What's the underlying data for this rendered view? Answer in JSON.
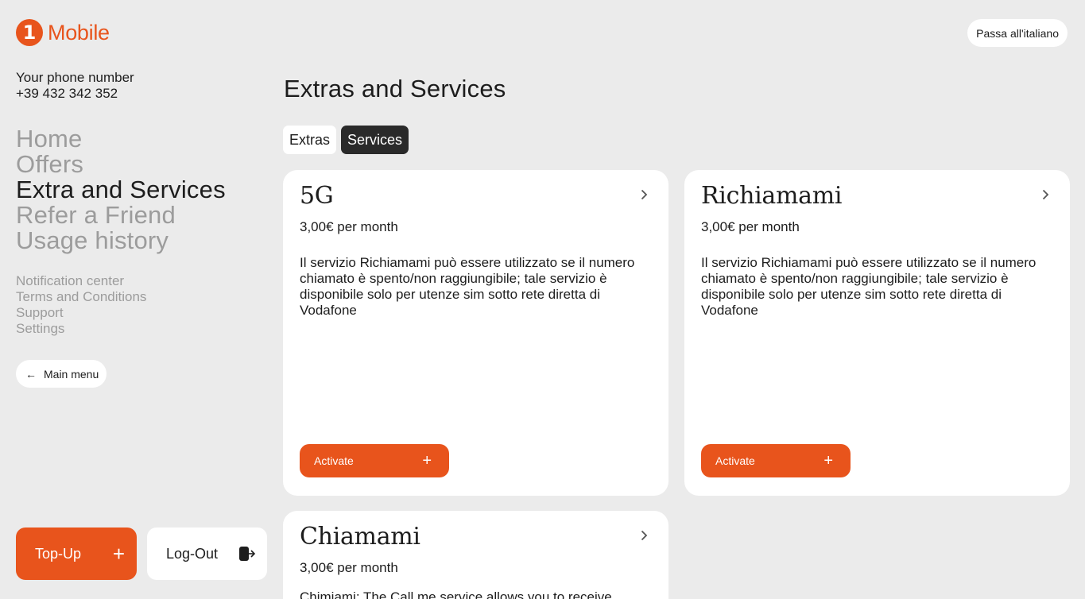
{
  "brand": {
    "logo_mark": "1",
    "name": "Mobile",
    "accent": "#e8541c"
  },
  "language_switch": "Passa all'italiano",
  "account": {
    "phone_label": "Your phone number",
    "phone_number": "+39 432 342 352"
  },
  "main_nav": [
    {
      "label": "Home",
      "active": false
    },
    {
      "label": "Offers",
      "active": false
    },
    {
      "label": "Extra and Services",
      "active": true
    },
    {
      "label": "Refer a Friend",
      "active": false
    },
    {
      "label": "Usage history",
      "active": false
    }
  ],
  "secondary_nav": [
    "Notification center",
    "Terms and Conditions",
    "Support",
    "Settings"
  ],
  "main_menu_button": {
    "icon": "arrow-left-icon",
    "label": "Main menu"
  },
  "topup_button": {
    "label": "Top-Up",
    "icon": "plus-icon"
  },
  "logout_button": {
    "label": "Log-Out",
    "icon": "logout-icon"
  },
  "page_title": "Extras and Services",
  "tabs": [
    {
      "label": "Extras",
      "active": false
    },
    {
      "label": "Services",
      "active": true
    }
  ],
  "cards": [
    {
      "title": "5G",
      "price": "3,00€ per month",
      "description": "Il servizio Richiamami può essere utilizzato se il numero chiamato è spento/non raggiungibile; tale servizio è disponibile solo per utenze sim sotto rete diretta di Vodafone",
      "button": "Activate"
    },
    {
      "title": "Richiamami",
      "price": "3,00€ per month",
      "description": "Il servizio Richiamami può essere utilizzato se il numero chiamato è spento/non raggiungibile; tale servizio è disponibile solo per utenze sim sotto rete diretta di Vodafone",
      "button": "Activate"
    },
    {
      "title": "Chiamami",
      "price": "3,00€ per month",
      "description": "Chimiami: The Call me service allows you to receive",
      "button": ""
    }
  ]
}
